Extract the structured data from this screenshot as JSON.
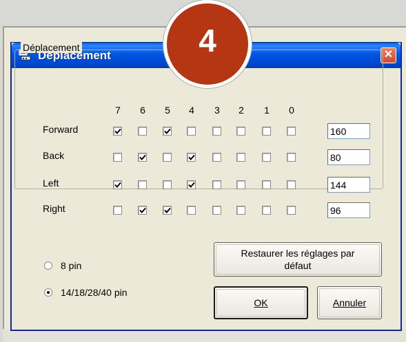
{
  "badge": "4",
  "window": {
    "title": "Déplacement",
    "close_symbol": "✕"
  },
  "group": {
    "legend": "Déplacement"
  },
  "columns": [
    "7",
    "6",
    "5",
    "4",
    "3",
    "2",
    "1",
    "0"
  ],
  "rows": [
    {
      "label": "Forward",
      "bits": [
        true,
        false,
        true,
        false,
        false,
        false,
        false,
        false
      ],
      "value": "160"
    },
    {
      "label": "Back",
      "bits": [
        false,
        true,
        false,
        true,
        false,
        false,
        false,
        false
      ],
      "value": "80"
    },
    {
      "label": "Left",
      "bits": [
        true,
        false,
        false,
        true,
        false,
        false,
        false,
        false
      ],
      "value": "144"
    },
    {
      "label": "Right",
      "bits": [
        false,
        true,
        true,
        false,
        false,
        false,
        false,
        false
      ],
      "value": "96"
    }
  ],
  "pins": {
    "options": [
      {
        "label": "8 pin",
        "selected": false
      },
      {
        "label": "14/18/28/40 pin",
        "selected": true
      }
    ]
  },
  "buttons": {
    "restore": "Restaurer les réglages par défaut",
    "ok": "OK",
    "cancel": "Annuler"
  }
}
